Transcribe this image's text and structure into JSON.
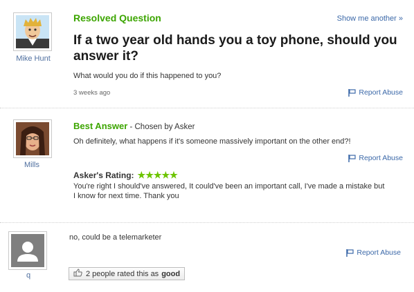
{
  "question": {
    "status_label": "Resolved Question",
    "show_another": "Show me another »",
    "title": "If a two year old hands you a toy phone, should you answer it?",
    "details": "What would you do if this happened to you?",
    "time_ago": "3 weeks ago",
    "report_label": "Report Abuse",
    "asker_name": "Mike Hunt"
  },
  "best_answer": {
    "label": "Best Answer",
    "chosen_by": " - Chosen by Asker",
    "text": "Oh definitely, what happens if it's someone massively important on the other end?!",
    "report_label": "Report Abuse",
    "answerer_name": "Mills",
    "rating_label": "Asker's Rating:",
    "rating_stars": "★★★★★",
    "rating_value": 5,
    "rating_comment": "You're right I should've answered, It could've been an important call, I've made a mistake but I know for next time. Thank you"
  },
  "other_answer": {
    "text": "no, could be a telemarketer",
    "report_label": "Report Abuse",
    "answerer_name": "q",
    "rated_count_text": "2 people rated this as",
    "rated_good": "good"
  },
  "colors": {
    "green": "#3ca500",
    "link_blue": "#3b68a8",
    "username_blue": "#4f6f9f"
  }
}
